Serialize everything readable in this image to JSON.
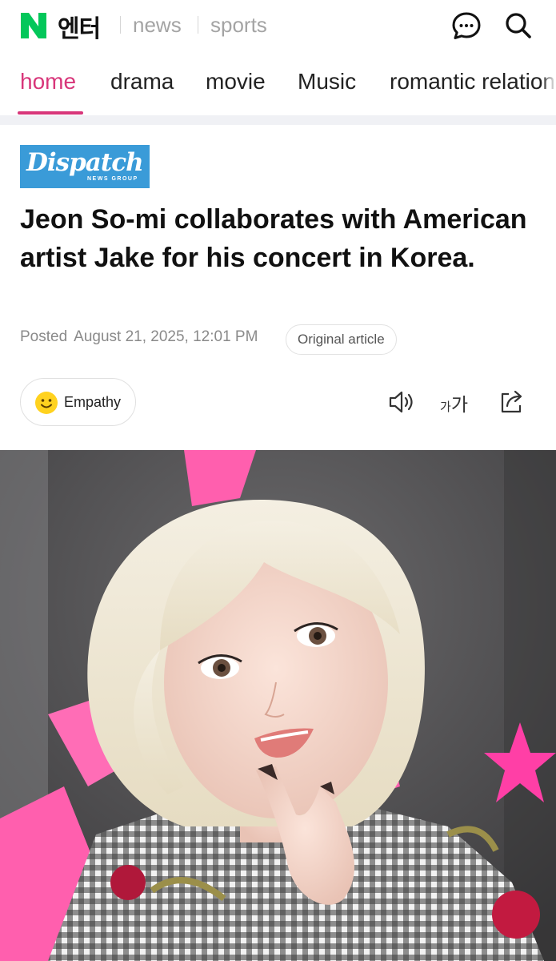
{
  "header": {
    "logo_letter": "N",
    "logo_text": "엔터",
    "links": [
      "news",
      "sports"
    ],
    "icons": [
      "chat-bubble-icon",
      "search-icon"
    ],
    "brand_color": "#03c75a"
  },
  "tabs": {
    "items": [
      "home",
      "drama",
      "movie",
      "Music",
      "romantic relations"
    ],
    "active_index": 0,
    "active_color": "#d8367a"
  },
  "article": {
    "press": {
      "name": "Dispatch",
      "tagline": "NEWS GROUP",
      "color": "#3a9bd8"
    },
    "headline": "Jeon So-mi collaborates with American artist Jake for his concert in Korea.",
    "posted_label": "Posted",
    "posted_time": "August 21, 2025, 12:01 PM",
    "original_article_label": "Original article"
  },
  "actions": {
    "empathy_label": "Empathy",
    "font_size_small": "가",
    "font_size_big": "가",
    "icons": [
      "smile-icon",
      "speaker-icon",
      "font-size-icon",
      "share-icon"
    ]
  },
  "photo": {
    "description_icon": "article-photo"
  }
}
